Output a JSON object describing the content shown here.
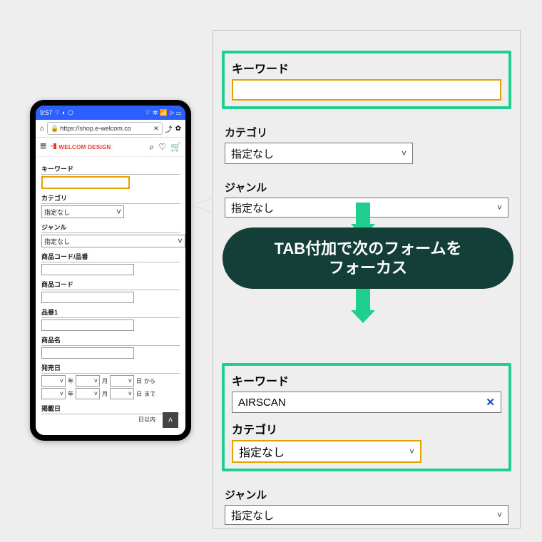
{
  "phone": {
    "status_time": "9:57",
    "status_left_extra": "⌔ ◐ ⬡",
    "status_right": "⌔ ✲ 📶 ⌲ ▭",
    "url_text": "https://shop.e-welcom.co",
    "brand": "WELCOM DESIGN",
    "labels": {
      "keyword": "キーワード",
      "category": "カテゴリ",
      "genre": "ジャンル",
      "code_or_part": "商品コード/品番",
      "code": "商品コード",
      "part1": "品番1",
      "name": "商品名",
      "release": "発売日",
      "posted": "掲載日"
    },
    "default_option": "指定なし",
    "date": {
      "year": "年",
      "month": "月",
      "day": "日",
      "from": "から",
      "to": "まで",
      "within": "日以内"
    }
  },
  "panel": {
    "labels": {
      "keyword": "キーワード",
      "category": "カテゴリ",
      "genre": "ジャンル"
    },
    "default_option": "指定なし",
    "filled_keyword": "AIRSCAN"
  },
  "callout": {
    "line1": "TAB付加で次のフォームを",
    "line2": "フォーカス"
  }
}
